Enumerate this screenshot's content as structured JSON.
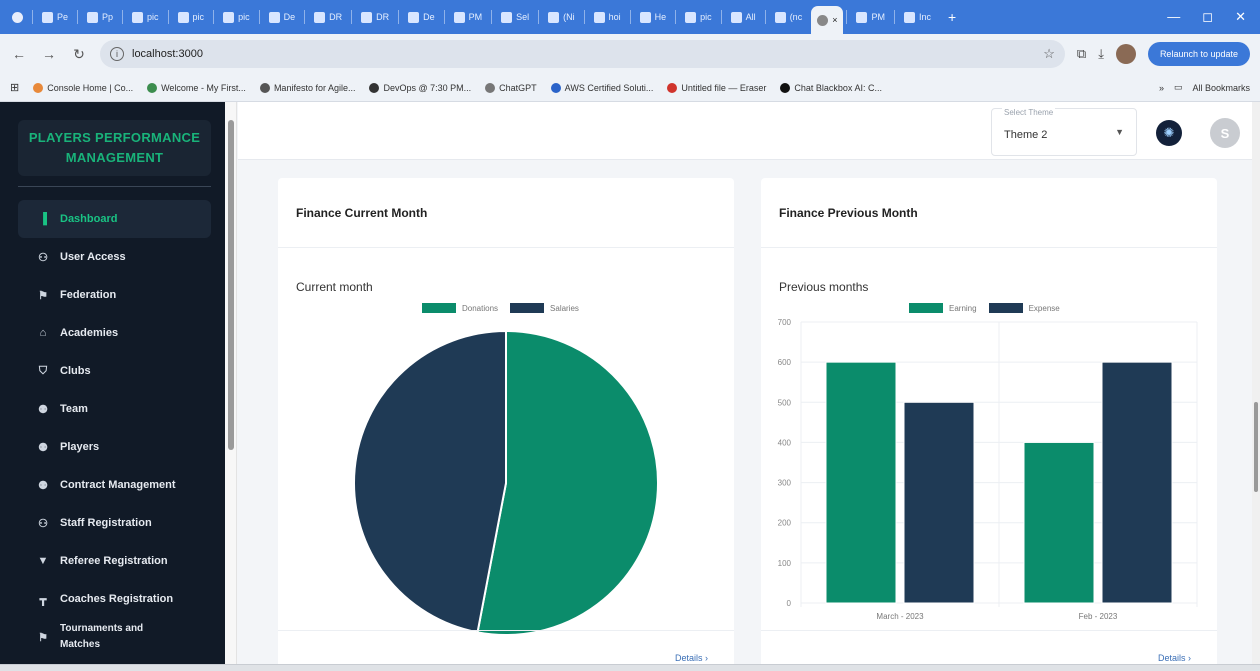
{
  "browser": {
    "tabs": [
      {
        "label": "Pe"
      },
      {
        "label": "Pp"
      },
      {
        "label": "pic"
      },
      {
        "label": "pic"
      },
      {
        "label": "pic"
      },
      {
        "label": "De"
      },
      {
        "label": "DR"
      },
      {
        "label": "DR"
      },
      {
        "label": "De"
      },
      {
        "label": "PM"
      },
      {
        "label": "Sel"
      },
      {
        "label": "(Ni"
      },
      {
        "label": "hoi"
      },
      {
        "label": "He"
      },
      {
        "label": "pic"
      },
      {
        "label": "All"
      },
      {
        "label": "(nc"
      }
    ],
    "active_tab_close": "×",
    "after_tabs": [
      {
        "label": "PM"
      },
      {
        "label": "Inc"
      }
    ],
    "new_tab": "+",
    "window_controls": [
      "—",
      "◻",
      "✕"
    ],
    "url": "localhost:3000",
    "relaunch_label": "Relaunch to update",
    "bookmarks": [
      {
        "label": "Console Home | Co...",
        "color": "#e8893a"
      },
      {
        "label": "Welcome - My First...",
        "color": "#3c8d4e"
      },
      {
        "label": "Manifesto for Agile...",
        "color": "#555555"
      },
      {
        "label": "DevOps @ 7:30 PM...",
        "color": "#333333"
      },
      {
        "label": "ChatGPT",
        "color": "#777777"
      },
      {
        "label": "AWS Certified Soluti...",
        "color": "#2a63c9"
      },
      {
        "label": "Untitled file — Eraser",
        "color": "#d0342c"
      },
      {
        "label": "Chat Blackbox AI: C...",
        "color": "#111111"
      }
    ],
    "all_bookmarks_label": "All Bookmarks"
  },
  "sidebar": {
    "brand": "PLAYERS PERFORMANCE MANAGEMENT",
    "items": [
      {
        "label": "Dashboard",
        "icon": "bar-chart-icon",
        "glyph": "▐",
        "active": true
      },
      {
        "label": "User Access",
        "icon": "user-access-icon",
        "glyph": "⚇"
      },
      {
        "label": "Federation",
        "icon": "flag-icon",
        "glyph": "⚑"
      },
      {
        "label": "Academies",
        "icon": "graduation-cap-icon",
        "glyph": "⌂"
      },
      {
        "label": "Clubs",
        "icon": "shield-icon",
        "glyph": "⛉"
      },
      {
        "label": "Team",
        "icon": "team-icon",
        "glyph": "⚉"
      },
      {
        "label": "Players",
        "icon": "players-icon",
        "glyph": "⚉"
      },
      {
        "label": "Contract Management",
        "icon": "contract-icon",
        "glyph": "⚉"
      },
      {
        "label": "Staff Registration",
        "icon": "staff-icon",
        "glyph": "⚇"
      },
      {
        "label": "Referee Registration",
        "icon": "whistle-icon",
        "glyph": "▼"
      },
      {
        "label": "Coaches Registration",
        "icon": "coach-icon",
        "glyph": "┳"
      },
      {
        "label": "Tournaments and Matches",
        "icon": "tournament-flag-icon",
        "glyph": "⚑"
      }
    ]
  },
  "topbar": {
    "theme_label": "Select Theme",
    "theme_value": "Theme 2",
    "avatar_initial": "S"
  },
  "cards": {
    "current": {
      "title": "Finance Current Month",
      "details": "Details  ›"
    },
    "previous": {
      "title": "Finance Previous Month",
      "details": "Details  ›"
    }
  },
  "colors": {
    "green": "#0b8c6b",
    "navy": "#1f3a55"
  },
  "chart_data": [
    {
      "type": "pie",
      "title": "Current month",
      "labels": [
        "Donations",
        "Salaries"
      ],
      "values": [
        53,
        47
      ],
      "colors": [
        "#0b8c6b",
        "#1f3a55"
      ],
      "legend": "top"
    },
    {
      "type": "bar",
      "title": "Previous months",
      "categories": [
        "March - 2023",
        "Feb - 2023"
      ],
      "series": [
        {
          "name": "Earning",
          "values": [
            600,
            400
          ],
          "color": "#0b8c6b"
        },
        {
          "name": "Expense",
          "values": [
            500,
            600
          ],
          "color": "#1f3a55"
        }
      ],
      "ylim": [
        0,
        700
      ],
      "yticks": [
        0,
        100,
        200,
        300,
        400,
        500,
        600,
        700
      ],
      "grid": true,
      "legend": "top"
    }
  ]
}
